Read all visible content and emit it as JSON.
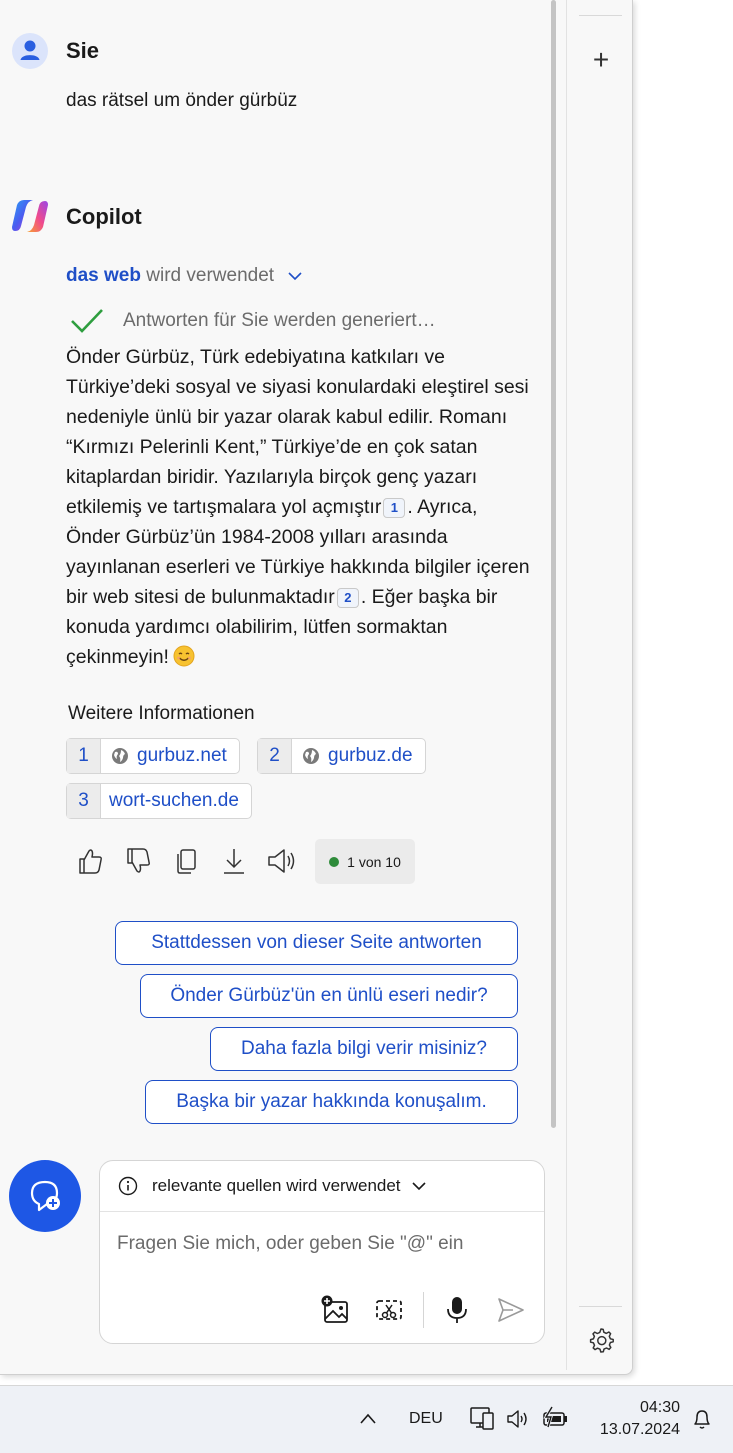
{
  "user_message": {
    "sender": "Sie",
    "text": "das rätsel um önder gürbüz"
  },
  "assistant": {
    "sender": "Copilot",
    "web_status": {
      "highlight": "das web",
      "rest": "wird verwendet"
    },
    "generating": "Antworten für Sie werden generiert…",
    "answer": {
      "p1": "Önder Gürbüz, Türk edebiyatına katkıları ve Türkiye’deki sosyal ve siyasi konulardaki eleştirel sesi nedeniyle ünlü bir yazar olarak kabul edilir. Romanı “Kırmızı Pelerinli Kent,” Türkiye’de en çok satan kitaplardan biridir. Yazılarıyla birçok genç yazarı etkilemiş ve tartışmalara yol açmıştır",
      "cite1": "1",
      "p2": ". Ayrıca, Önder Gürbüz’ün 1984-2008 yılları arasında yayınlanan eserleri ve Türkiye hakkında bilgiler içeren bir web sitesi de bulunmaktadır",
      "cite2": "2",
      "p3": ". Eğer başka bir konuda yardımcı olabilirim, lütfen sormaktan çekinmeyin!"
    },
    "more_info_title": "Weitere Informationen",
    "sources": [
      {
        "num": "1",
        "label": "gurbuz.net"
      },
      {
        "num": "2",
        "label": "gurbuz.de"
      },
      {
        "num": "3",
        "label": "wort-suchen.de"
      }
    ],
    "counter": "1 von 10"
  },
  "suggestions": [
    "Stattdessen von dieser Seite antworten",
    "Önder Gürbüz'ün en ünlü eseri nedir?",
    "Daha fazla bilgi verir misiniz?",
    "Başka bir yazar hakkında konuşalım."
  ],
  "composer": {
    "context": "relevante quellen wird verwendet",
    "placeholder": "Fragen Sie mich, oder geben Sie \"@\" ein"
  },
  "taskbar": {
    "language": "DEU",
    "time": "04:30",
    "date": "13.07.2024"
  },
  "colors": {
    "accent": "#1f4fc7",
    "new_chat_button": "#1e57e5",
    "check": "#2e9e3f"
  }
}
